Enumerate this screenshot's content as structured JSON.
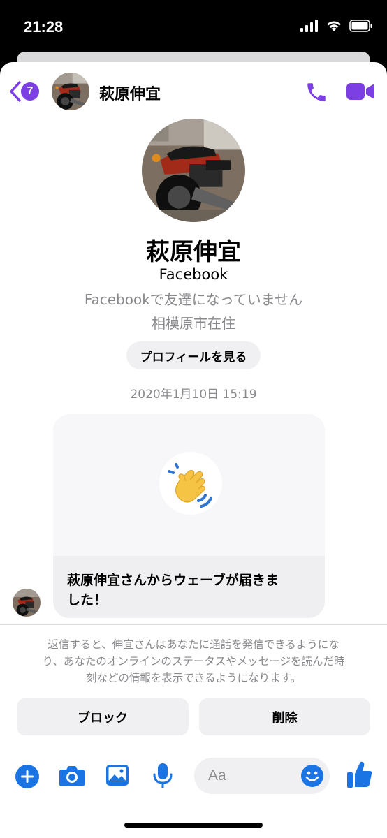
{
  "status_bar": {
    "time": "21:28"
  },
  "header": {
    "unread_count": "7",
    "contact_name": "萩原伸宜"
  },
  "profile": {
    "name": "萩原伸宜",
    "source": "Facebook",
    "friend_status": "Facebookで友達になっていません",
    "location": "相模原市在住",
    "view_profile_label": "プロフィールを見る"
  },
  "conversation": {
    "timestamp": "2020年1月10日 15:19",
    "wave_message_line1": "萩原伸宜さんからウェーブが届きま",
    "wave_message_line2": "した！"
  },
  "request_notice": {
    "line1": "返信すると、伸宜さんはあなたに通話を発信できるようにな",
    "line2": "り、あなたのオンラインのステータスやメッセージを読んだ時",
    "line3": "刻などの情報を表示できるようになります。"
  },
  "actions": {
    "block_label": "ブロック",
    "delete_label": "削除"
  },
  "composer": {
    "placeholder": "Aa"
  },
  "colors": {
    "accent": "#7b3fe4",
    "blue": "#1b74e4"
  }
}
